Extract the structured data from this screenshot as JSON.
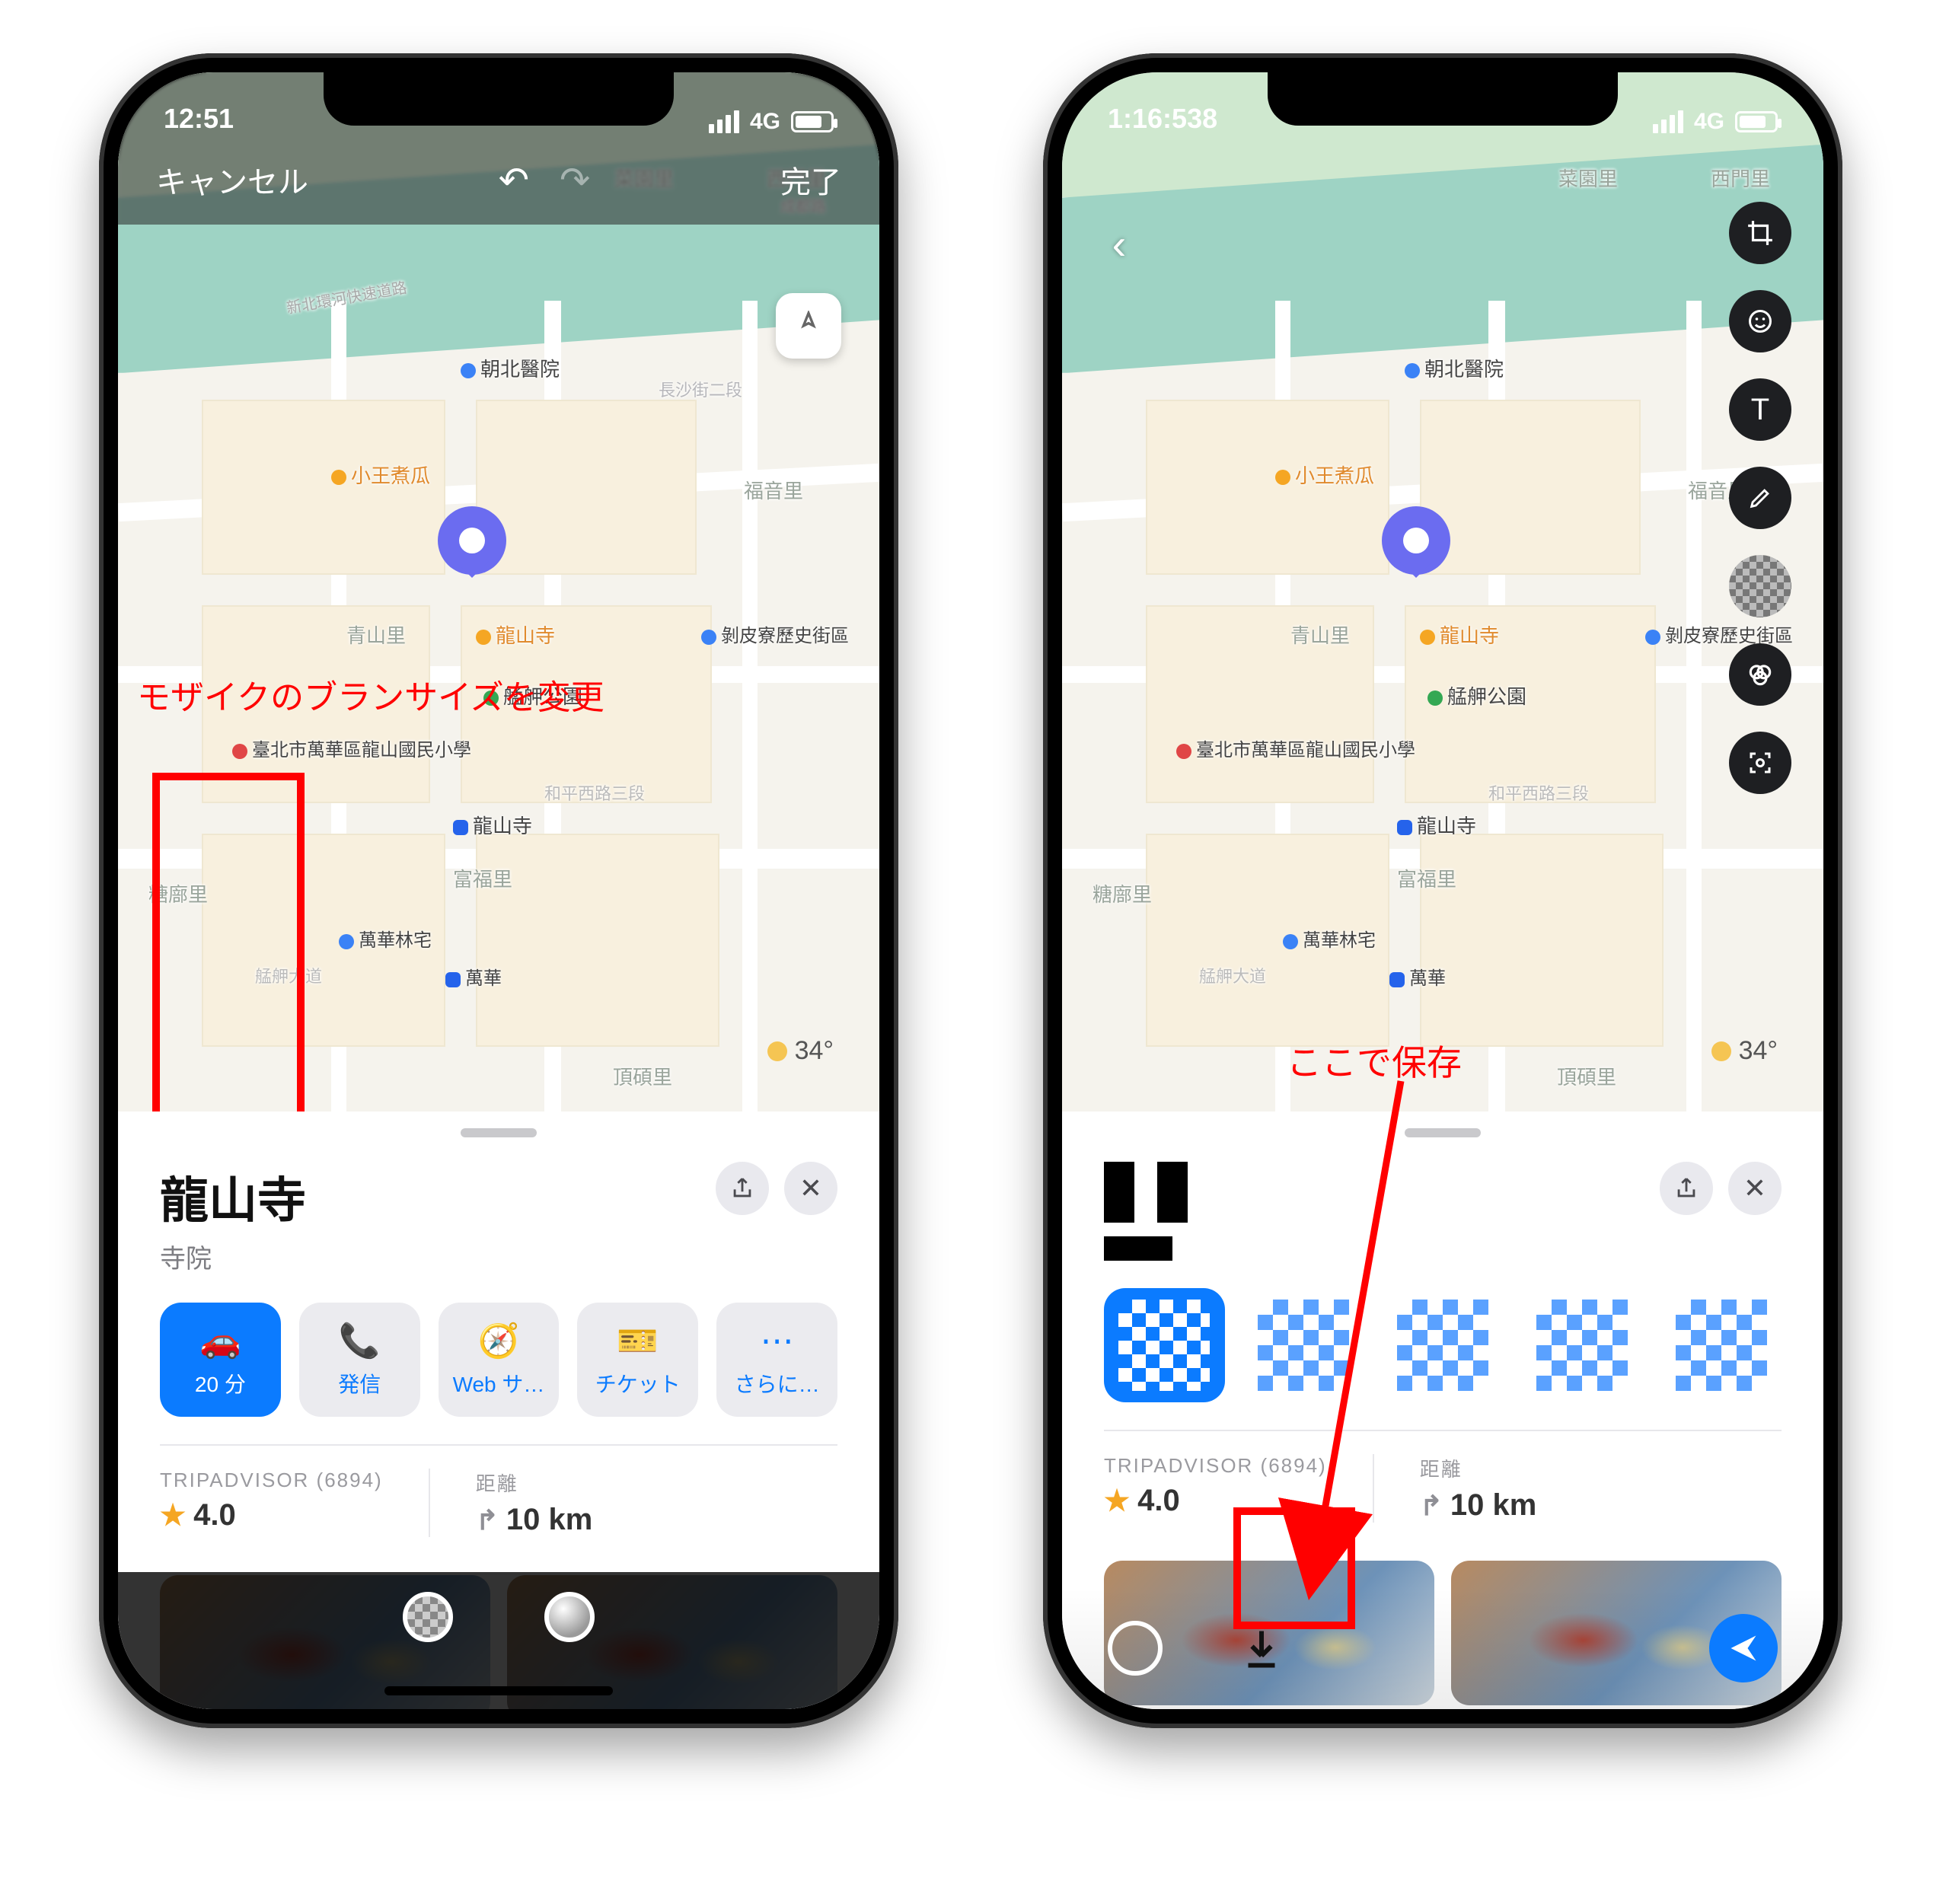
{
  "left": {
    "status": {
      "time": "12:51",
      "net": "4G"
    },
    "edit_header": {
      "cancel": "キャンセル",
      "done": "完了"
    },
    "map": {
      "weather_temp": "34°",
      "poi": {
        "hospital": "朝北醫院",
        "chaoyang_rd": "長沙街二段",
        "xiaowang": "小王煮瓜",
        "fuyin": "福音里",
        "qingshan": "青山里",
        "longshansi": "龍山寺",
        "bopiliao": "剝皮寮歷史街區",
        "mengjia_park": "艋舺公園",
        "school": "臺北市萬華區龍山國民小學",
        "heping_rd": "和平西路三段",
        "metro": "龍山寺",
        "fufu": "富福里",
        "tangbu": "糖廍里",
        "wanhua_hostel": "萬華林宅",
        "mengjia_blvd": "艋舺大道",
        "wanhua_station": "萬華",
        "dingshuo": "頂碩里",
        "ximen": "西門里",
        "caiyuan": "菜園里",
        "chengdu": "成都路",
        "beixin": "新北環河快速道路"
      }
    },
    "sheet": {
      "title": "龍山寺",
      "subtitle": "寺院",
      "buttons": {
        "drive": "20 分",
        "call": "発信",
        "web": "Web サ…",
        "ticket": "チケット",
        "more": "さらに…"
      },
      "trip_label": "TRIPADVISOR (6894)",
      "trip_rating": "4.0",
      "dist_label": "距離",
      "dist_value": "10 km"
    },
    "annot_brush": "モザイクのブランサイズを変更"
  },
  "right": {
    "status": {
      "time": "1:16:538",
      "net": "4G"
    },
    "map": {
      "weather_temp": "34°",
      "poi_same_as_left": true
    },
    "sheet": {
      "trip_label": "TRIPADVISOR (6894)",
      "trip_rating": "4.0",
      "dist_label": "距離",
      "dist_value": "10 km"
    },
    "annot_save": "ここで保存"
  }
}
